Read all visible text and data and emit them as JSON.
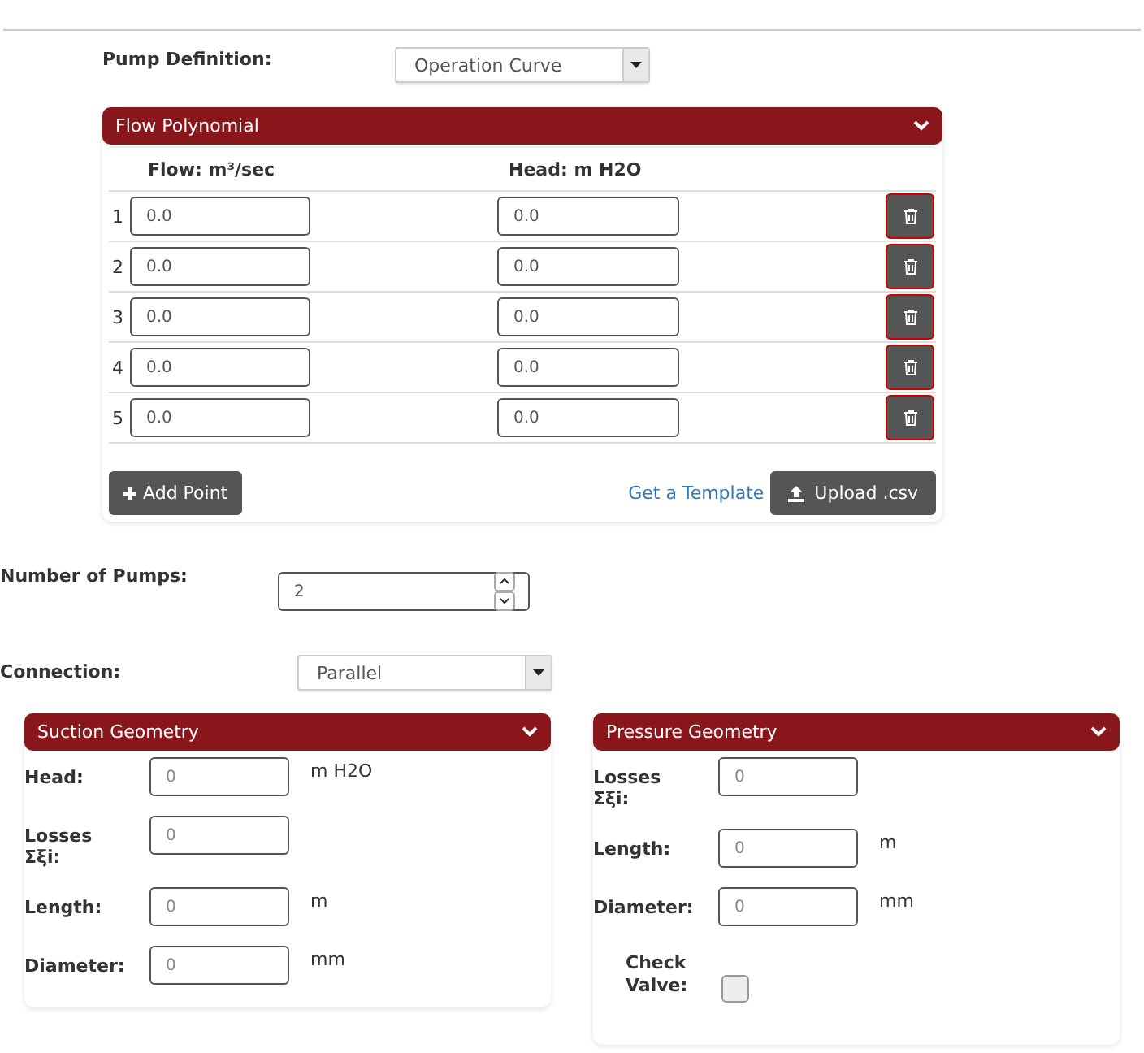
{
  "pump_definition": {
    "label": "Pump Definition:",
    "value": "Operation Curve"
  },
  "flow_polynomial": {
    "title": "Flow Polynomial",
    "expanded": true,
    "columns": [
      "Flow: m³/sec",
      "Head: m H2O"
    ],
    "rows": [
      {
        "index": "1",
        "flow": "0.0",
        "head": "0.0"
      },
      {
        "index": "2",
        "flow": "0.0",
        "head": "0.0"
      },
      {
        "index": "3",
        "flow": "0.0",
        "head": "0.0"
      },
      {
        "index": "4",
        "flow": "0.0",
        "head": "0.0"
      },
      {
        "index": "5",
        "flow": "0.0",
        "head": "0.0"
      }
    ],
    "add_button": "Add Point",
    "template_link": "Get a Template",
    "upload_button": "Upload .csv"
  },
  "number_of_pumps": {
    "label": "Number of Pumps:",
    "value": "2"
  },
  "connection": {
    "label": "Connection:",
    "value": "Parallel"
  },
  "suction_geometry": {
    "title": "Suction Geometry",
    "expanded": true,
    "fields": [
      {
        "label": "Head:",
        "placeholder": "0",
        "unit": "m H2O"
      },
      {
        "label": "Losses Σξi:",
        "placeholder": "0"
      },
      {
        "label": "Length:",
        "placeholder": "0",
        "unit": "m"
      },
      {
        "label": "Diameter:",
        "placeholder": "0",
        "unit": "mm"
      }
    ]
  },
  "pressure_geometry": {
    "title": "Pressure Geometry",
    "expanded": true,
    "fields": [
      {
        "label": "Losses Σξi:",
        "placeholder": "0"
      },
      {
        "label": "Length:",
        "placeholder": "0",
        "unit": "m"
      },
      {
        "label": "Diameter:",
        "placeholder": "0",
        "unit": "mm"
      }
    ],
    "check_valve": {
      "label": "Check Valve:",
      "checked": false
    }
  }
}
